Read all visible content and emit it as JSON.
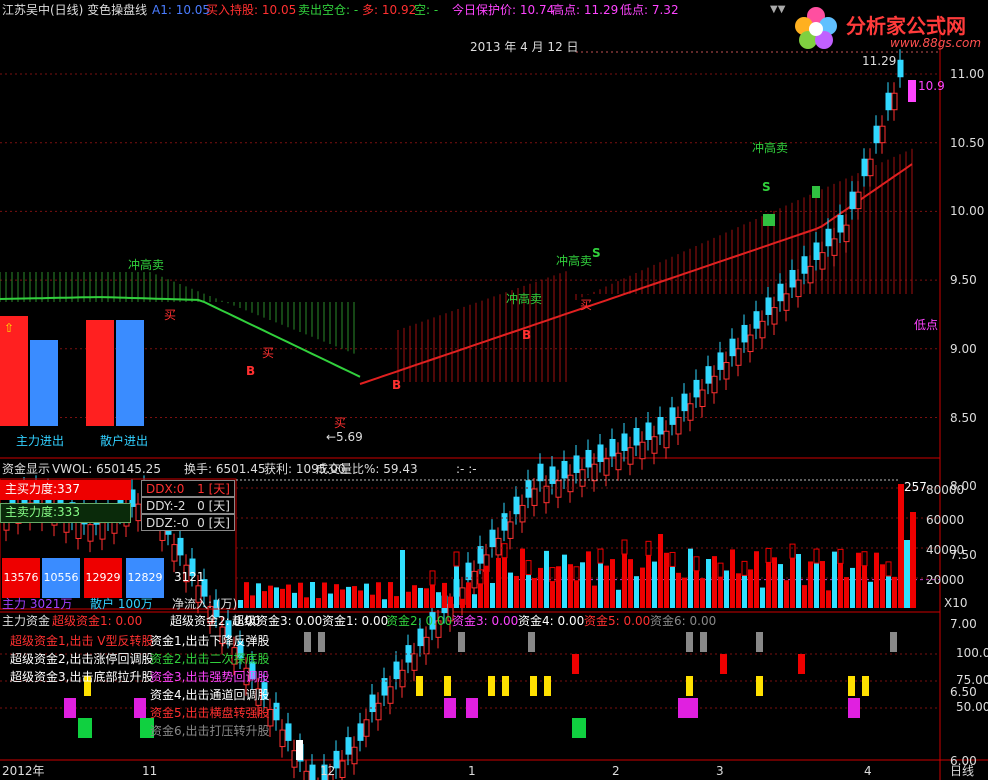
{
  "header": {
    "title": "江苏吴中(日线) 变色操盘线",
    "items": [
      {
        "label": "A1: 10.05",
        "color": "#4a7cff"
      },
      {
        "label": "买入持股: 10.05",
        "color": "#ff3030"
      },
      {
        "label": "卖出空仓: -",
        "color": "#31d03c"
      },
      {
        "label": "多: 10.92",
        "color": "#ff3030"
      },
      {
        "label": "空: -",
        "color": "#31d03c"
      },
      {
        "label": "今日保护价: 10.74",
        "color": "#ff44ff"
      },
      {
        "label": "高点: 11.29",
        "color": "#ff44ff"
      },
      {
        "label": "低点: 7.32",
        "color": "#ff44ff"
      }
    ],
    "symbols": "▼▼"
  },
  "logo": {
    "brand": "分析家公式网",
    "url": "www.88gs.com"
  },
  "main_chart": {
    "date_label": "2013 年 4 月 12 日",
    "high_label": "11.29",
    "last_label": "10.9",
    "low_label": "低点",
    "min_label": "←5.69",
    "y_ticks": [
      "11.00",
      "10.50",
      "10.00",
      "9.50",
      "9.00",
      "8.50",
      "8.00",
      "7.50",
      "7.00",
      "6.50",
      "6.00"
    ],
    "annotations": [
      "冲高卖",
      "冲高卖",
      "冲高卖",
      "冲高卖",
      "买",
      "买",
      "买",
      "买",
      "B",
      "B",
      "B",
      "S",
      "S"
    ],
    "flow_labels": {
      "main": "主力进出",
      "retail": "散户进出"
    }
  },
  "money_panel": {
    "title": "资金显示",
    "vol": "VWOL: 650145.25",
    "turnover": "换手: 6501.45",
    "profit": "获利: 1095.00",
    "ratio": "成交量比%: 59.43",
    "extra": ":-   :-",
    "buy_strength": "主买力度:337",
    "sell_strength": "主卖力度:333",
    "ddx": [
      "DDX:0",
      "1 [天]"
    ],
    "ddy": [
      "DDY:-2",
      "0 [天]"
    ],
    "ddz": [
      "DDZ:-0",
      "0 [天]"
    ],
    "flows": [
      "13576",
      "10556",
      "12929",
      "12829",
      "3121"
    ],
    "main_label": "主力 3021万",
    "retail_label": "散户 100万",
    "net_label": "净流入: (万)",
    "peak": "257",
    "y_ticks": [
      "80000",
      "60000",
      "40000",
      "20000"
    ],
    "unit": "X10"
  },
  "fund_panel": {
    "header": [
      {
        "label": "主力资金",
        "color": "#dddddd"
      },
      {
        "label": "超级资金1: 0.00",
        "color": "#ff3030"
      },
      {
        "label": "超级资金2: 0.00",
        "color": "#ffffff"
      },
      {
        "label": "超级资金3: 0.00",
        "color": "#ffffff"
      },
      {
        "label": "资金1: 0.00",
        "color": "#ffffff"
      },
      {
        "label": "资金2: 0.00",
        "color": "#31d03c"
      },
      {
        "label": "资金3: 0.00",
        "color": "#ff44ff"
      },
      {
        "label": "资金4: 0.00",
        "color": "#ffffff"
      },
      {
        "label": "资金5: 0.00",
        "color": "#ff3030"
      },
      {
        "label": "资金6: 0.00",
        "color": "#888888"
      }
    ],
    "legend_left": [
      {
        "label": "超级资金1,出击 V型反转股",
        "color": "#ff3030"
      },
      {
        "label": "超级资金2,出击涨停回调股",
        "color": "#ffffff"
      },
      {
        "label": "超级资金3,出击底部拉升股",
        "color": "#ffffff"
      }
    ],
    "legend_right": [
      {
        "label": "资金1,出击下降反弹股",
        "color": "#ffffff"
      },
      {
        "label": "资金2,出击二次探底股",
        "color": "#31d03c"
      },
      {
        "label": "资金3,出击强势回调股",
        "color": "#ff44ff"
      },
      {
        "label": "资金4,出击通道回调股",
        "color": "#ffffff"
      },
      {
        "label": "资金5,出击横盘转强股",
        "color": "#ff3030"
      },
      {
        "label": "资金6,出击打压转升股",
        "color": "#888888"
      }
    ],
    "y_ticks": [
      "100.0",
      "75.00",
      "50.00"
    ]
  },
  "x_axis": {
    "labels": [
      "2012年",
      "11",
      "12",
      "1",
      "2",
      "3",
      "4"
    ],
    "period": "日线"
  }
}
